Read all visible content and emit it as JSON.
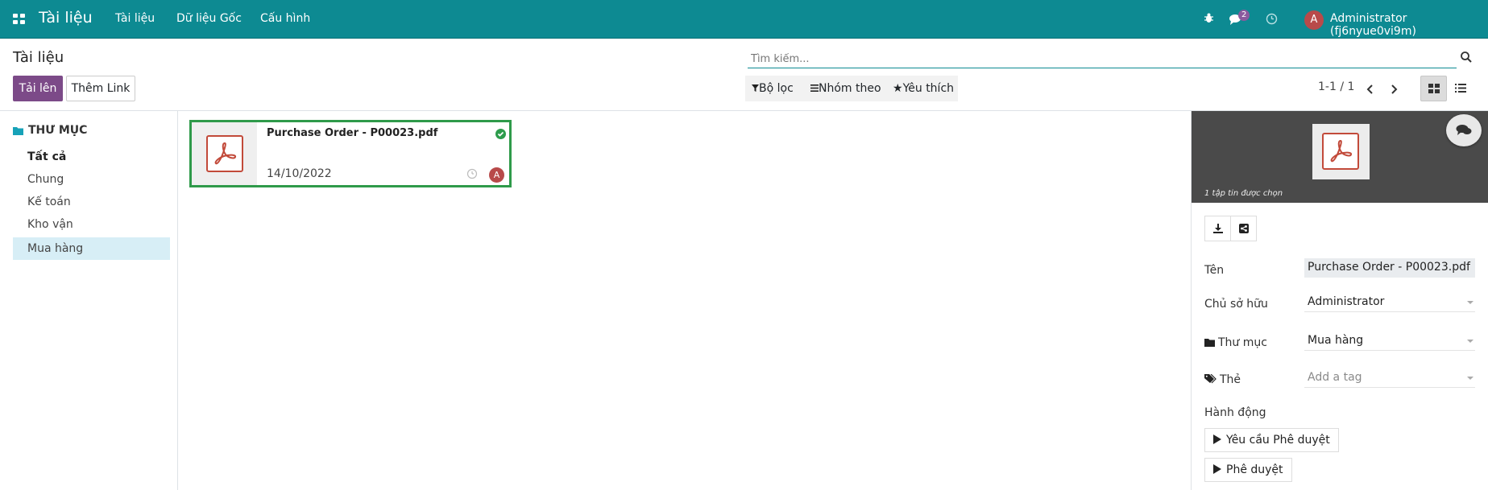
{
  "navbar": {
    "app_title": "Tài liệu",
    "menu": [
      "Tài liệu",
      "Dữ liệu Gốc",
      "Cấu hình"
    ],
    "chat_count": "2",
    "avatar_letter": "A",
    "username": "Administrator (fj6nyue0vi9m)"
  },
  "control": {
    "page_title": "Tài liệu",
    "upload_label": "Tải lên",
    "add_link_label": "Thêm Link",
    "search_placeholder": "Tìm kiếm...",
    "filters_label": "Bộ lọc",
    "group_by_label": "Nhóm theo",
    "favorites_label": "Yêu thích",
    "pager": "1-1 / 1"
  },
  "sidebar": {
    "heading": "THƯ MỤC",
    "items": [
      {
        "label": "Tất cả",
        "selected": false
      },
      {
        "label": "Chung",
        "selected": false
      },
      {
        "label": "Kế toán",
        "selected": false
      },
      {
        "label": "Kho vận",
        "selected": false
      },
      {
        "label": "Mua hàng",
        "selected": true
      }
    ]
  },
  "card": {
    "name": "Purchase Order - P00023.pdf",
    "date": "14/10/2022",
    "owner_letter": "A"
  },
  "inspector": {
    "caption": "1 tập tin được chọn",
    "fields": {
      "name_label": "Tên",
      "name_value": "Purchase Order - P00023.pdf",
      "owner_label": "Chủ sở hữu",
      "owner_value": "Administrator",
      "folder_label": "Thư mục",
      "folder_value": "Mua hàng",
      "tags_label": "Thẻ",
      "tags_placeholder": "Add a tag"
    },
    "actions_label": "Hành động",
    "actions": [
      "Yêu cầu Phê duyệt",
      "Phê duyệt"
    ]
  },
  "colors": {
    "navbar": "#0d8a92",
    "primary_button": "#7c4a88",
    "selected_card_border": "#2f9a4a",
    "selected_folder": "#d7eef6",
    "pdf_red": "#c24a3a"
  }
}
